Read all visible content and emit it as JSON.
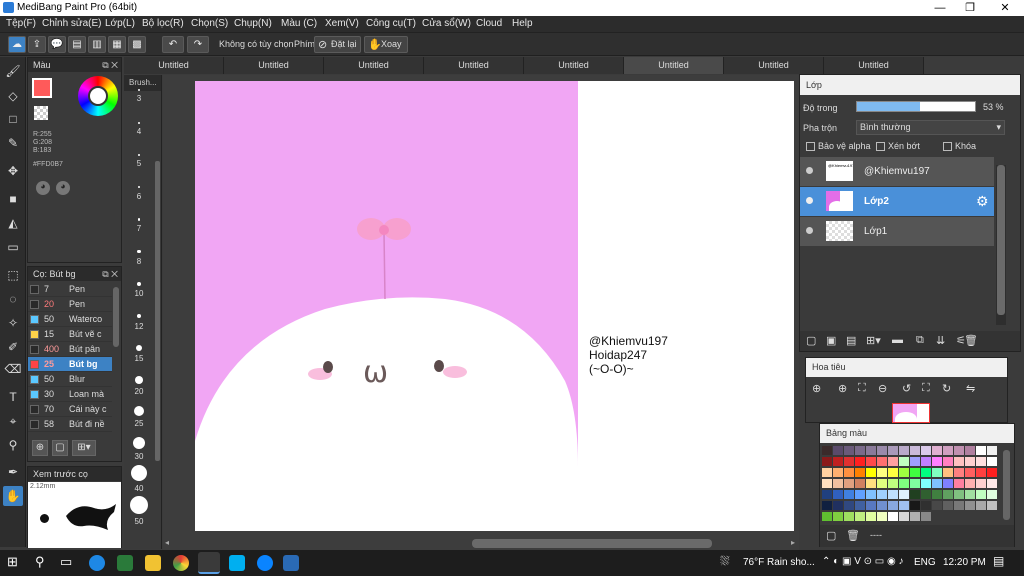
{
  "window": {
    "title": "MediBang Paint Pro (64bit)",
    "controls": [
      "—",
      "❐",
      "✕"
    ]
  },
  "menu": [
    "Tệp(F)",
    "Chỉnh sửa(E)",
    "Lớp(L)",
    "Bộ lọc(R)",
    "Chọn(S)",
    "Chụp(N)",
    "Màu (C)",
    "Xem(V)",
    "Công cụ(T)",
    "Cửa sổ(W)",
    "Cloud",
    "Help"
  ],
  "toolbar": {
    "no_option": "Không có tùy chọn",
    "key_label": "Phím",
    "reset": "Đặt lại",
    "rotate": "Xoay"
  },
  "color_panel": {
    "title": "Màu",
    "r": "R:255",
    "g": "G:208",
    "b": "B:183",
    "hex": "#FFD0B7",
    "fg": "#ff5a5a",
    "bg": "#ffffff"
  },
  "brush_panel": {
    "title": "Cọ: Bút bg",
    "items": [
      {
        "size": "7",
        "name": "Pen",
        "color": "#2a2a2a",
        "size_color": "#dddddd"
      },
      {
        "size": "20",
        "name": "Pen",
        "color": "#2a2a2a",
        "size_color": "#ff7b7b"
      },
      {
        "size": "50",
        "name": "Waterco",
        "color": "#5bc8ff",
        "size_color": "#dddddd"
      },
      {
        "size": "15",
        "name": "Bút vẽ c",
        "color": "#ffd24a",
        "size_color": "#dddddd"
      },
      {
        "size": "400",
        "name": "Bút pân",
        "color": "#2a2a2a",
        "size_color": "#ff9b9b"
      },
      {
        "size": "25",
        "name": "Bút bg",
        "color": "#ff4444",
        "size_color": "#ff9b9b"
      },
      {
        "size": "50",
        "name": "Blur",
        "color": "#5bc8ff",
        "size_color": "#dddddd"
      },
      {
        "size": "30",
        "name": "Loan mà",
        "color": "#5bc8ff",
        "size_color": "#dddddd"
      },
      {
        "size": "70",
        "name": "Cái này c",
        "color": "#2a2a2a",
        "size_color": "#dddddd"
      },
      {
        "size": "58",
        "name": "Bút đi nề",
        "color": "#2a2a2a",
        "size_color": "#dddddd"
      }
    ]
  },
  "preview_panel": {
    "title": "Xem trước cọ",
    "size": "2.12mm"
  },
  "brush_sizes": [
    "3",
    "4",
    "5",
    "6",
    "7",
    "8",
    "10",
    "12",
    "15",
    "20",
    "25",
    "30",
    "40",
    "50"
  ],
  "panel_labels": {
    "brush": "Brush..."
  },
  "tabs": [
    "Untitled",
    "Untitled",
    "Untitled",
    "Untitled",
    "Untitled",
    "Untitled",
    "Untitled",
    "Untitled"
  ],
  "canvas": {
    "text_line1": "@Khiemvu197",
    "text_line2": "Hoidap247",
    "text_line3": "(~O-O)~",
    "face_mouth": "ω"
  },
  "layer_panel": {
    "title": "Lớp",
    "opacity_label": "Độ trong",
    "opacity_value": "53 %",
    "opacity": 0.53,
    "blend_label": "Pha trộn",
    "blend_value": "Bình thường",
    "protect_alpha": "Bảo vệ alpha",
    "clipping": "Xén bớt",
    "lock": "Khóa",
    "layers": [
      {
        "name": "@Khiemvu197",
        "thumb_text": "@Khiemvu197"
      },
      {
        "name": "Lớp2"
      },
      {
        "name": "Lớp1"
      }
    ]
  },
  "nav_panel": {
    "title": "Hoa tiêu"
  },
  "palette_panel": {
    "title": "Bảng màu",
    "footer": "----"
  },
  "taskbar": {
    "weather": "76°F  Rain sho...",
    "lang": "ENG",
    "time": "12:20 PM"
  }
}
